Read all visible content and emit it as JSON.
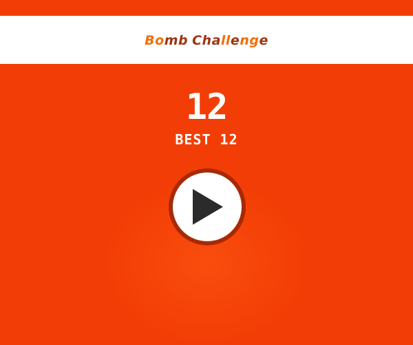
{
  "game": {
    "title_parts": [
      {
        "text": "B",
        "color": "#f26f0a"
      },
      {
        "text": "o",
        "color": "#f26f0a"
      },
      {
        "text": "mb",
        "color": "#9e3413"
      },
      {
        "text": " ",
        "color": "#9e3413"
      },
      {
        "text": "Cha",
        "color": "#9e3413"
      },
      {
        "text": "ll",
        "color": "#f26f0a"
      },
      {
        "text": "e",
        "color": "#9e3413"
      },
      {
        "text": "ng",
        "color": "#f26f0a"
      },
      {
        "text": "e",
        "color": "#9e3413"
      }
    ],
    "score": "12",
    "best_label": "BEST 12"
  },
  "play_button": {
    "icon": "play-icon"
  },
  "colors": {
    "background": "#f23e06",
    "header": "#ffffff",
    "text": "#ffffff",
    "button_ring": "#a72a05",
    "button_fill": "#ffffff",
    "play_triangle": "#2b2b2b"
  }
}
